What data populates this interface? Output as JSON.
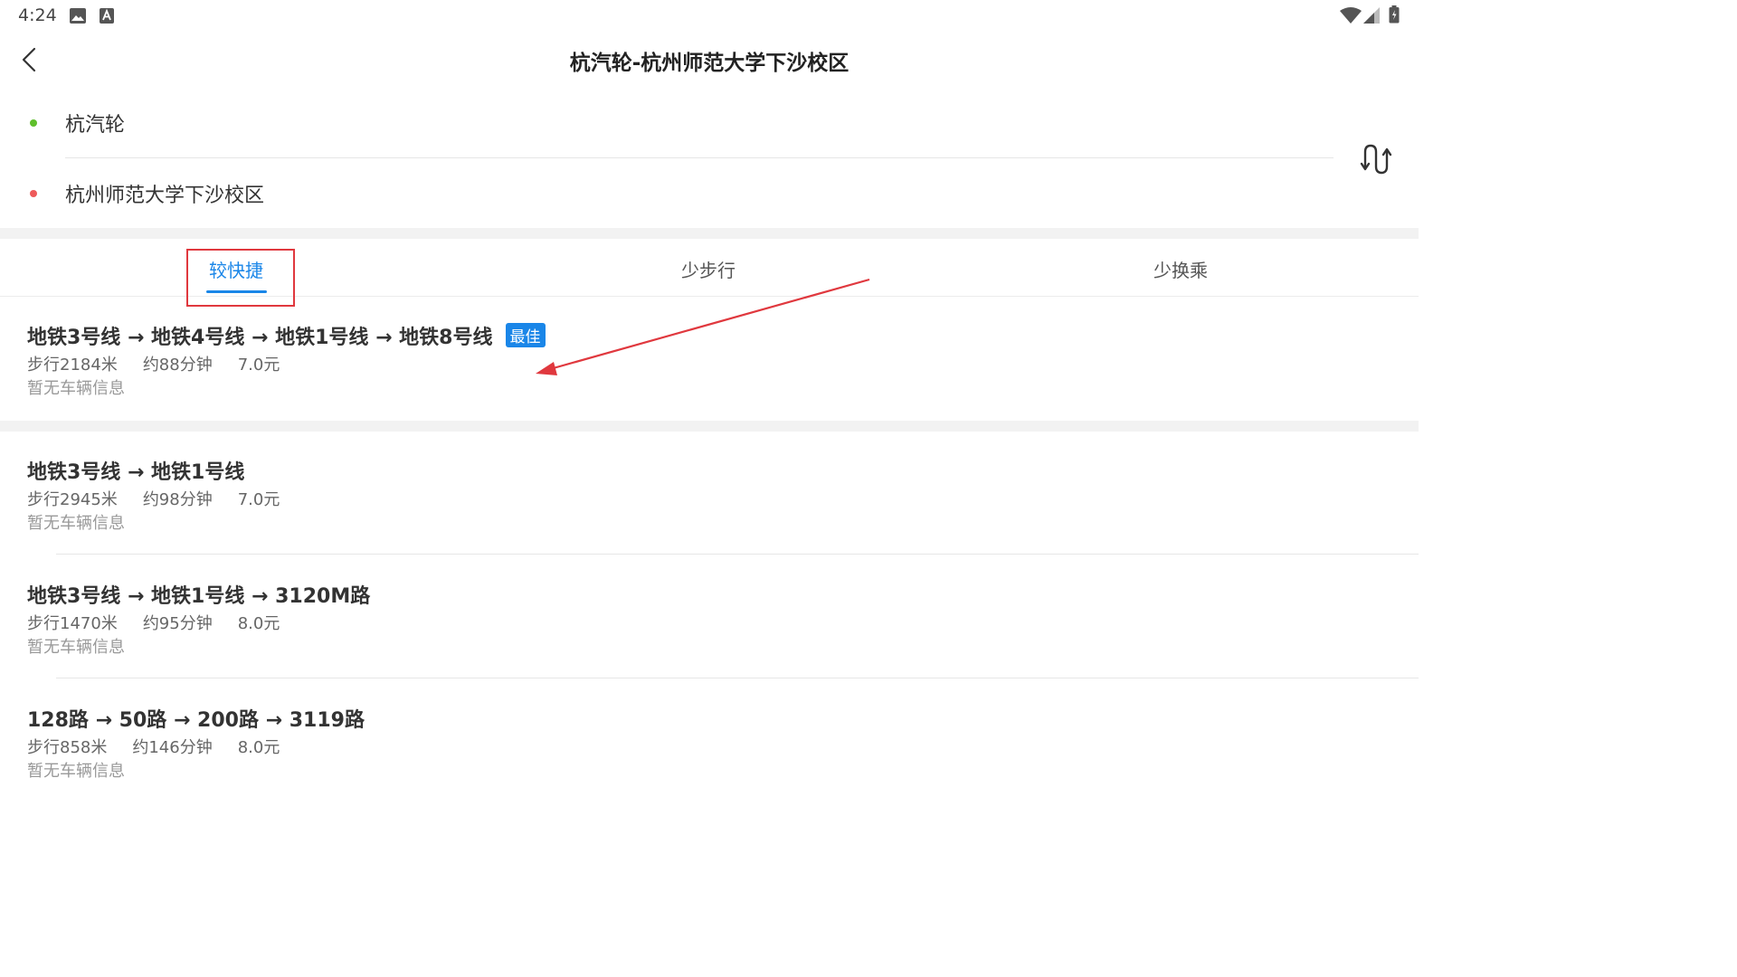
{
  "status_bar": {
    "time": "4:24",
    "left_icons": [
      "image-icon",
      "a-box-icon"
    ],
    "right_icons": [
      "wifi-icon",
      "cell-signal-icon",
      "battery-icon"
    ]
  },
  "header": {
    "title": "杭汽轮-杭州师范大学下沙校区",
    "back_icon": "chevron-left-icon"
  },
  "places": {
    "origin": {
      "label": "杭汽轮",
      "dot_color": "#5fbf2c"
    },
    "destination": {
      "label": "杭州师范大学下沙校区",
      "dot_color": "#ee5a5a"
    },
    "swap_icon": "swap-route-icon"
  },
  "tabs": [
    {
      "label": "较快捷",
      "active": true
    },
    {
      "label": "少步行",
      "active": false
    },
    {
      "label": "少换乘",
      "active": false
    }
  ],
  "colors": {
    "accent": "#1a86e8",
    "annotation": "#e0383e"
  },
  "routes": [
    {
      "title": "地铁3号线 → 地铁4号线 → 地铁1号线 → 地铁8号线",
      "badge": "最佳",
      "walk": "步行2184米",
      "duration": "约88分钟",
      "price": "7.0元",
      "note": "暂无车辆信息"
    },
    {
      "title": "地铁3号线 → 地铁1号线",
      "walk": "步行2945米",
      "duration": "约98分钟",
      "price": "7.0元",
      "note": "暂无车辆信息"
    },
    {
      "title": "地铁3号线 → 地铁1号线 → 3120M路",
      "walk": "步行1470米",
      "duration": "约95分钟",
      "price": "8.0元",
      "note": "暂无车辆信息"
    },
    {
      "title": "128路 → 50路 → 200路 → 3119路",
      "walk": "步行858米",
      "duration": "约146分钟",
      "price": "8.0元",
      "note": "暂无车辆信息"
    }
  ]
}
